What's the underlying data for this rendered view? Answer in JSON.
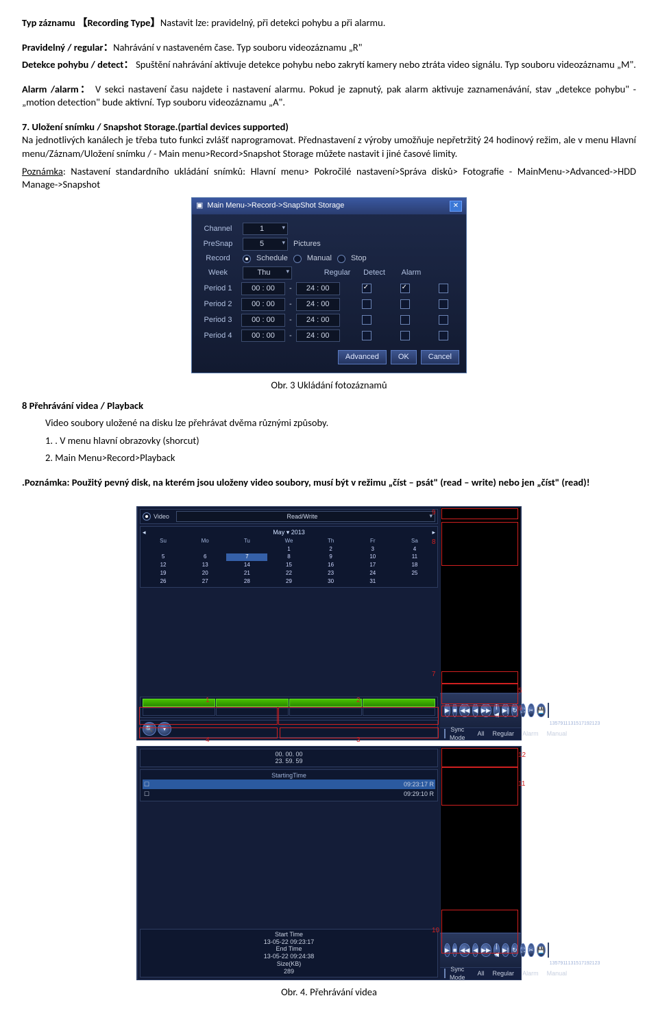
{
  "p1": {
    "label": "Typ záznamu 【Recording Type】",
    "rest": "Nastavit lze: pravidelný, při detekci pohybu a při alarmu."
  },
  "p2": {
    "label": "Pravidelný / regular：",
    "rest": "Nahrávání v nastaveném čase. Typ souboru videozáznamu „R\""
  },
  "p3": {
    "label": "Detekce pohybu / detect：",
    "rest": " Spuštění nahrávání aktivuje detekce pohybu nebo zakrytí kamery nebo ztráta video signálu. Typ souboru videozáznamu „M\"."
  },
  "p4": {
    "label": "Alarm /alarm：",
    "rest": " V sekci nastavení času najdete i nastavení alarmu. Pokud je zapnutý, pak alarm aktivuje zaznamenávání, stav „detekce pohybu\" - „motion detection\" bude aktivní. Typ souboru videozáznamu „A\"."
  },
  "p5": {
    "label": "7. Uložení snímku / Snapshot Storage.(partial devices supported)"
  },
  "p5b": "Na jednotlivých kanálech je třeba tuto funkci zvlášť naprogramovat. Přednastavení z výroby umožňuje nepřetržitý 24 hodinový režim, ale v menu Hlavní menu/Záznam/Uložení snímku / - Main menu>Record>Snapshot Storage můžete nastavit i jiné časové limity.",
  "p6": {
    "label": "Poznámka",
    "rest": ": Nastavení standardního ukládání snímků: Hlavní menu> Pokročilé nastavení>Správa disků> Fotografie - MainMenu->Advanced->HDD Manage->Snapshot"
  },
  "snapshot": {
    "title": "Main Menu->Record->SnapShot Storage",
    "channel": {
      "label": "Channel",
      "value": "1"
    },
    "presnap": {
      "label": "PreSnap",
      "value": "5",
      "unit": "Pictures"
    },
    "record": {
      "label": "Record",
      "opts": [
        "Schedule",
        "Manual",
        "Stop"
      ]
    },
    "week": {
      "label": "Week",
      "value": "Thu"
    },
    "cols": [
      "Regular",
      "Detect",
      "Alarm"
    ],
    "periods": [
      {
        "label": "Period 1",
        "t1": "00 : 00",
        "t2": "24 : 00",
        "c": [
          true,
          true,
          false
        ]
      },
      {
        "label": "Period 2",
        "t1": "00 : 00",
        "t2": "24 : 00",
        "c": [
          false,
          false,
          false
        ]
      },
      {
        "label": "Period 3",
        "t1": "00 : 00",
        "t2": "24 : 00",
        "c": [
          false,
          false,
          false
        ]
      },
      {
        "label": "Period 4",
        "t1": "00 : 00",
        "t2": "24 : 00",
        "c": [
          false,
          false,
          false
        ]
      }
    ],
    "buttons": [
      "Advanced",
      "OK",
      "Cancel"
    ]
  },
  "caption3": "Obr. 3 Ukládání fotozáznamů",
  "h8": "8 Přehrávání videa / Playback",
  "h8a": "Video soubory uložené na disku lze přehrávat dvěma různými způsoby.",
  "h8b": "1. . V menu hlavní obrazovky (shorcut)",
  "h8c": "2. Main Menu>Record>Playback",
  "note2": ".Poznámka: Použitý pevný disk, na kterém jsou uloženy video soubory, musí být v režimu „číst – psát\" (read – write) nebo jen „číst\" (read)!",
  "playback1": {
    "videoMode": "Video",
    "mode": "Read/Write",
    "cal": {
      "month": "May",
      "year": "2013",
      "dow": [
        "Su",
        "Mo",
        "Tu",
        "We",
        "Th",
        "Fr",
        "Sa"
      ],
      "days": [
        "",
        "",
        "",
        "1",
        "2",
        "3",
        "4",
        "5",
        "6",
        "7",
        "8",
        "9",
        "10",
        "11",
        "12",
        "13",
        "14",
        "15",
        "16",
        "17",
        "18",
        "19",
        "20",
        "21",
        "22",
        "23",
        "24",
        "25",
        "26",
        "27",
        "28",
        "29",
        "30",
        "31"
      ],
      "selected": "7"
    },
    "timeline": [
      "1",
      "3",
      "5",
      "7",
      "9",
      "11",
      "13",
      "15",
      "17",
      "19",
      "21",
      "23"
    ],
    "bottom": {
      "sync": "Sync Mode",
      "all": "All",
      "reg": "Regular",
      "alm": "Alarm",
      "man": "Manual"
    },
    "markers": [
      "9",
      "8",
      "7",
      "1",
      "2",
      "3",
      "4",
      "5",
      "6"
    ]
  },
  "playback2": {
    "timer": {
      "a": "00. 00. 00",
      "b": "23. 59. 59"
    },
    "starting": "StartingTime",
    "rows": [
      "09:23:17  R",
      "09:29:10  R"
    ],
    "info": {
      "start": "Start Time",
      "startv": "13-05-22 09:23:17",
      "end": "End Time",
      "endv": "13-05-22 09:24:38",
      "size": "Size(KB)",
      "sizev": "289"
    },
    "markers": [
      "12",
      "11",
      "10"
    ]
  },
  "caption4": "Obr. 4. Přehrávání videa"
}
